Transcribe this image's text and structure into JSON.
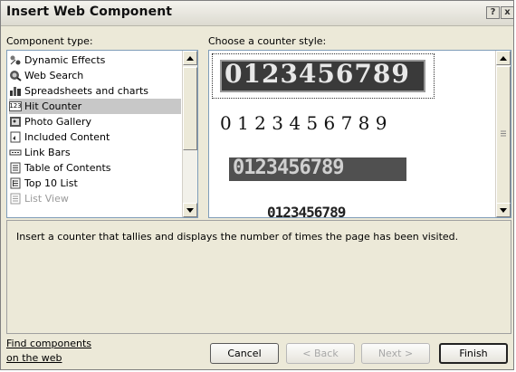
{
  "window": {
    "title": "Insert Web Component",
    "help_label": "?",
    "close_label": "x"
  },
  "component_type": {
    "label": "Component type:",
    "items": [
      {
        "label": "Dynamic Effects",
        "icon": "dynamic-effects-icon"
      },
      {
        "label": "Web Search",
        "icon": "web-search-icon"
      },
      {
        "label": "Spreadsheets and charts",
        "icon": "spreadsheets-icon"
      },
      {
        "label": "Hit Counter",
        "icon": "hit-counter-icon",
        "selected": true,
        "icon_text": "123"
      },
      {
        "label": "Photo Gallery",
        "icon": "photo-gallery-icon"
      },
      {
        "label": "Included Content",
        "icon": "included-content-icon"
      },
      {
        "label": "Link Bars",
        "icon": "link-bars-icon"
      },
      {
        "label": "Table of Contents",
        "icon": "table-of-contents-icon"
      },
      {
        "label": "Top 10 List",
        "icon": "top-10-list-icon"
      },
      {
        "label": "List View",
        "icon": "list-view-icon",
        "disabled": true
      }
    ]
  },
  "counter_style": {
    "label": "Choose a counter style:",
    "styles": [
      {
        "digits": "0123456789",
        "style": "odometer"
      },
      {
        "digits": "0 1 2 3 4 5 6 7 8 9",
        "style": "handwritten"
      },
      {
        "digits": "0123456789",
        "style": "led"
      },
      {
        "digits": "0123456789",
        "style": "typewriter"
      }
    ]
  },
  "description": "Insert a counter that tallies and displays the number of times the page has been visited.",
  "footer": {
    "find_link_line1": "Find components",
    "find_link_line2": "on the web",
    "cancel": "Cancel",
    "back": "< Back",
    "next": "Next >",
    "finish": "Finish"
  }
}
